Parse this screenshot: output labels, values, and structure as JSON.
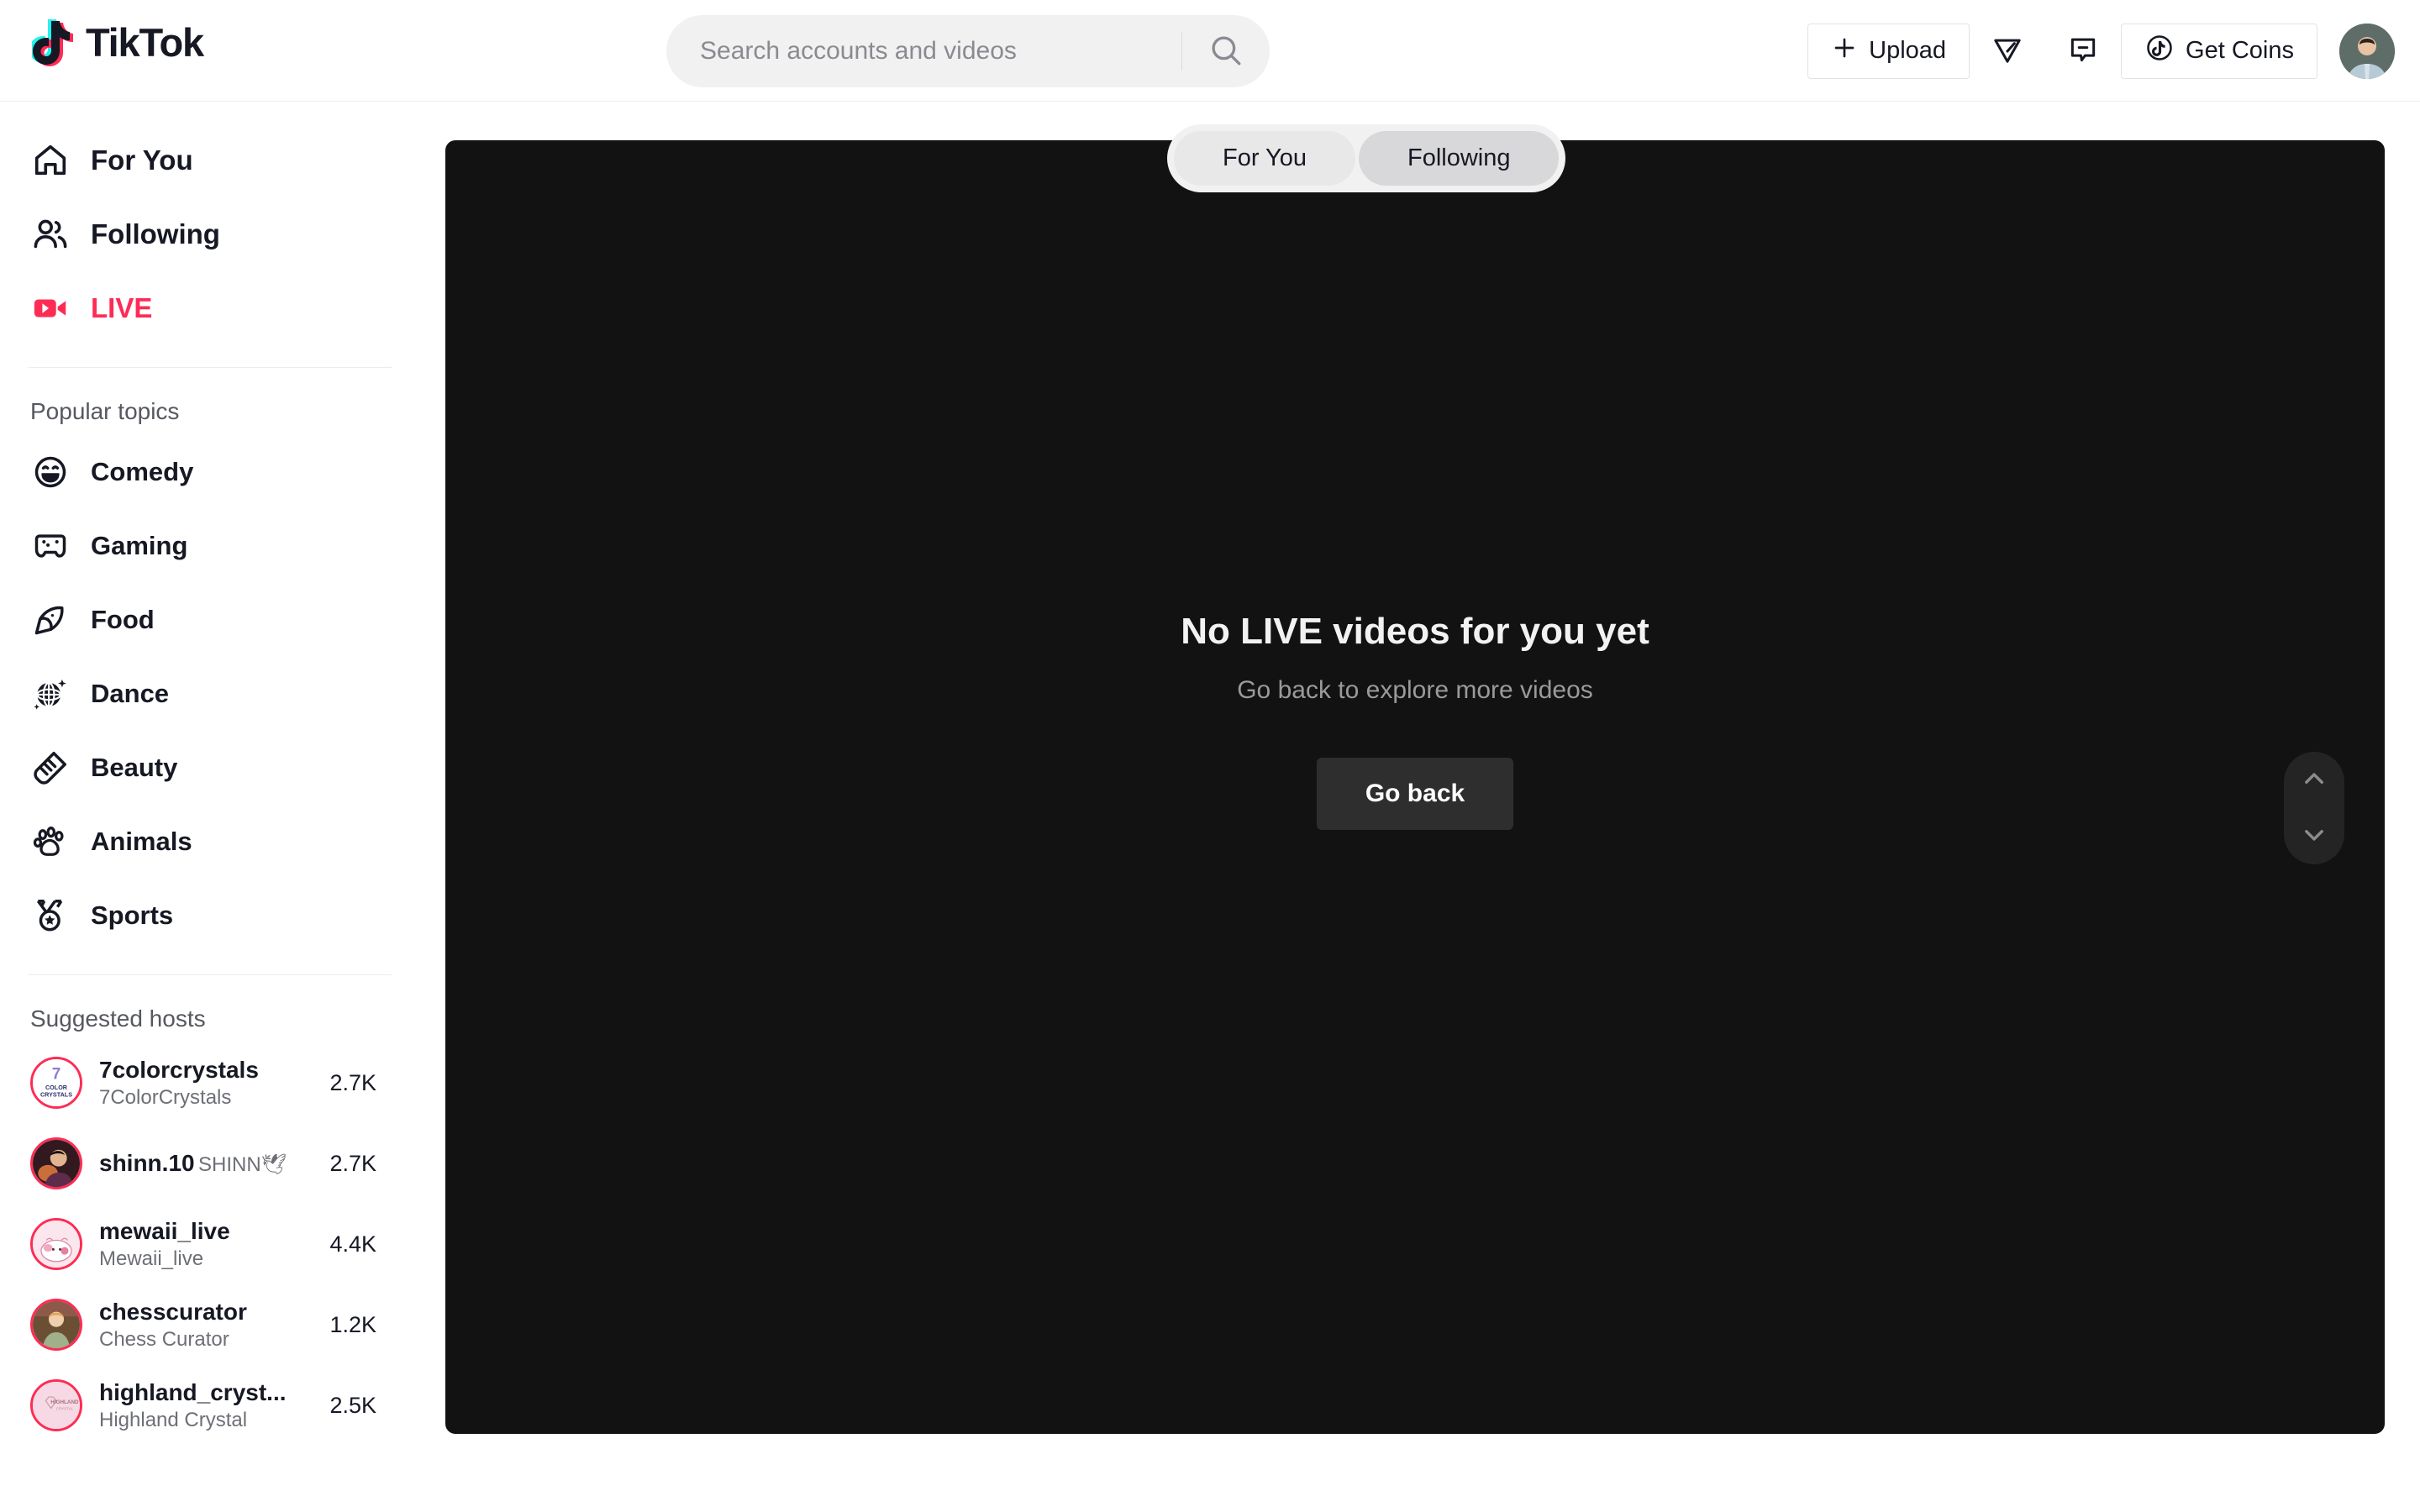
{
  "header": {
    "brand": "TikTok",
    "search": {
      "placeholder": "Search accounts and videos",
      "value": ""
    },
    "upload_label": "Upload",
    "get_coins_label": "Get Coins"
  },
  "sidebar": {
    "nav": [
      {
        "label": "For You",
        "icon": "home-icon",
        "active": false
      },
      {
        "label": "Following",
        "icon": "people-icon",
        "active": false
      },
      {
        "label": "LIVE",
        "icon": "live-video-icon",
        "active": true
      }
    ],
    "popular_topics_title": "Popular topics",
    "topics": [
      {
        "label": "Comedy",
        "icon": "smiley-icon"
      },
      {
        "label": "Gaming",
        "icon": "gamepad-icon"
      },
      {
        "label": "Food",
        "icon": "pizza-icon"
      },
      {
        "label": "Dance",
        "icon": "disco-ball-icon"
      },
      {
        "label": "Beauty",
        "icon": "brush-icon"
      },
      {
        "label": "Animals",
        "icon": "paw-icon"
      },
      {
        "label": "Sports",
        "icon": "medal-icon"
      }
    ],
    "suggested_hosts_title": "Suggested hosts",
    "hosts": [
      {
        "name": "7colorcrystals",
        "display": "7ColorCrystals",
        "count": "2.7K",
        "avatar_text": "7 COLOR CRYSTALS",
        "avatar_bg": "#ffffff",
        "avatar_fg": "#2b2f6b"
      },
      {
        "name": "shinn.10",
        "display": "SHINN🕊",
        "count": "2.7K",
        "avatar_text": "",
        "avatar_bg": "#3b2228",
        "avatar_fg": "#ffffff"
      },
      {
        "name": "mewaii_live",
        "display": "Mewaii_live",
        "count": "4.4K",
        "avatar_text": "",
        "avatar_bg": "#fbe4ec",
        "avatar_fg": "#d86a8c"
      },
      {
        "name": "chesscurator",
        "display": "Chess Curator",
        "count": "1.2K",
        "avatar_text": "",
        "avatar_bg": "#5a4b3a",
        "avatar_fg": "#ffffff"
      },
      {
        "name": "highland_cryst...",
        "display": "Highland Crystal",
        "count": "2.5K",
        "avatar_text": "HIGHLAND CRYSTAL",
        "avatar_bg": "#f6d9e4",
        "avatar_fg": "#b07f8c"
      }
    ]
  },
  "main": {
    "tabs": [
      {
        "label": "For You",
        "selected": false
      },
      {
        "label": "Following",
        "selected": true
      }
    ],
    "empty_state": {
      "title": "No LIVE videos for you yet",
      "subtitle": "Go back to explore more videos",
      "button_label": "Go back"
    }
  },
  "colors": {
    "brand_red": "#fe2c55",
    "brand_cyan": "#25f4ee",
    "text_primary": "#161823",
    "panel_bg": "#121212"
  }
}
